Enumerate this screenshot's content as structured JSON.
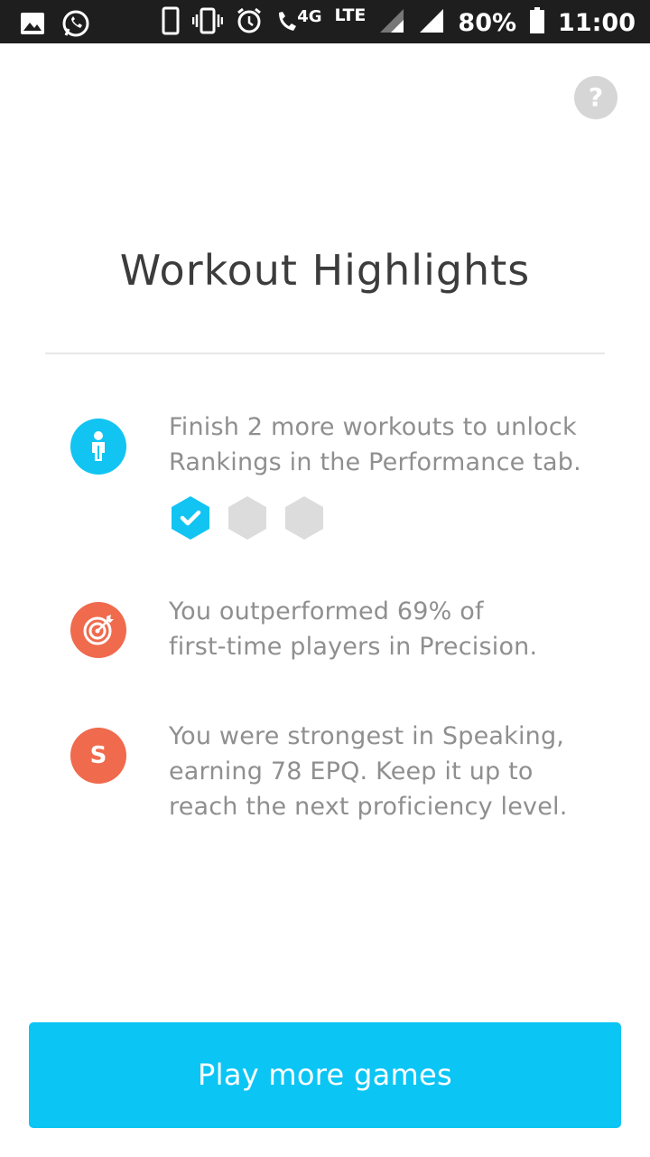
{
  "status_bar": {
    "network": "4G",
    "network_type": "LTE",
    "battery": "80%",
    "time": "11:00"
  },
  "header": {
    "help_symbol": "?",
    "title": "Workout Highlights"
  },
  "highlights": [
    {
      "icon": "person-icon",
      "icon_color": "#11c4f2",
      "text": "Finish 2 more workouts to unlock Rankings in the Performance tab.",
      "progress": {
        "completed": 1,
        "total": 3
      }
    },
    {
      "icon": "target-icon",
      "icon_color": "#f06a4d",
      "text": "You outperformed 69% of first-time players in Precision."
    },
    {
      "icon": "letter-s-icon",
      "icon_letter": "S",
      "icon_color": "#f06a4d",
      "text": "You were strongest in Speaking, earning 78 EPQ. Keep it up to reach the next proficiency level."
    }
  ],
  "cta": {
    "label": "Play more games"
  },
  "colors": {
    "accent": "#0bc5f4",
    "orange": "#f06a4d",
    "inactive": "#dcdcdc"
  }
}
